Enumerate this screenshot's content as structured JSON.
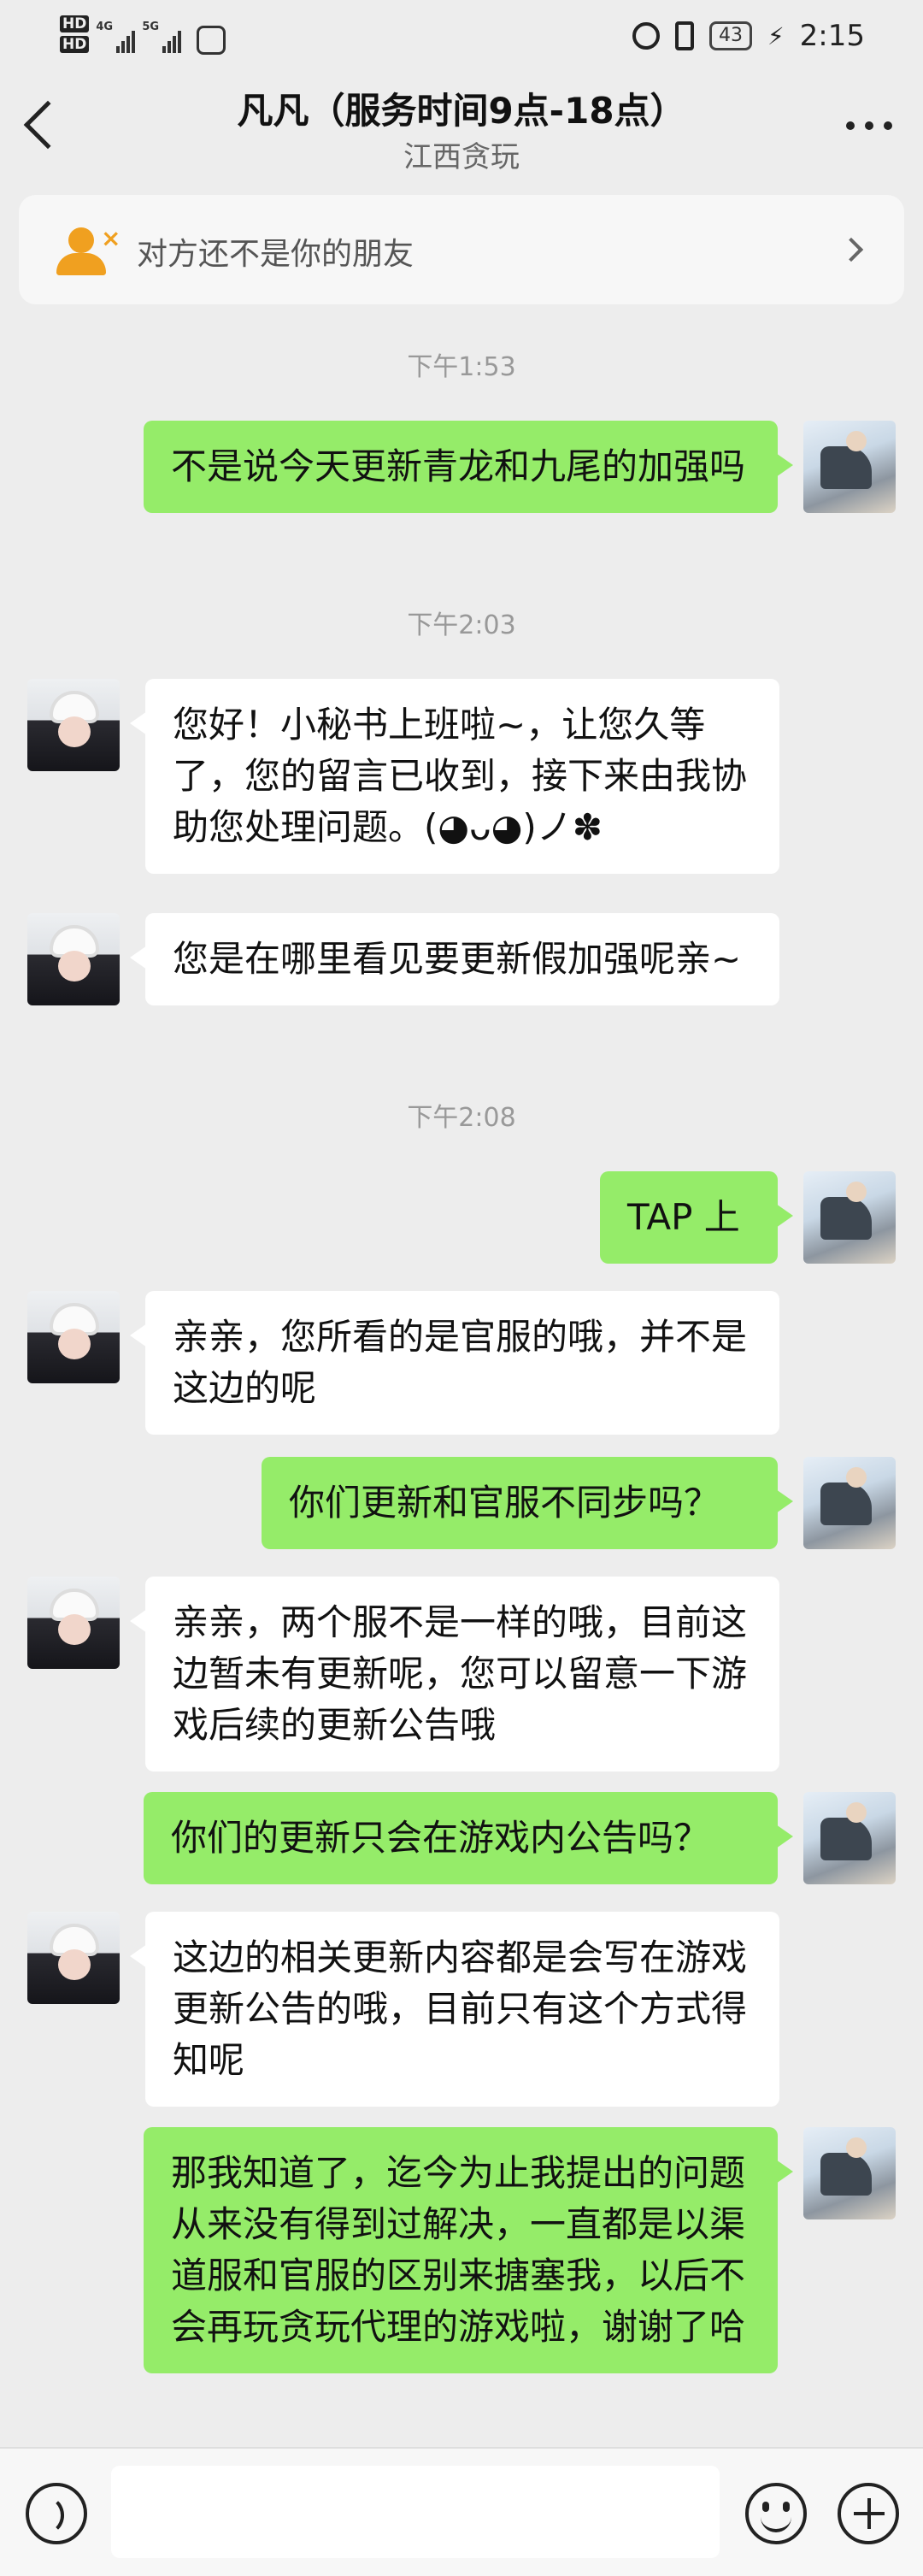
{
  "status_bar": {
    "hd1": "HD",
    "hd2": "HD",
    "net1": "4G",
    "net2": "5G",
    "battery": "43",
    "time": "2:15"
  },
  "header": {
    "title": "凡凡（服务时间9点-18点）",
    "subtitle": "江西贪玩"
  },
  "banner": {
    "text": "对方还不是你的朋友"
  },
  "timestamps": [
    "下午1:53",
    "下午2:03",
    "下午2:08"
  ],
  "messages": [
    {
      "sender": "me",
      "text": "不是说今天更新青龙和九尾的加强吗"
    },
    {
      "sender": "other",
      "text": "您好！小秘书上班啦~，让您久等了，您的留言已收到，接下来由我协助您处理问题。(◕ᴗ◕)ノ✽"
    },
    {
      "sender": "other",
      "text": "您是在哪里看见要更新假加强呢亲~"
    },
    {
      "sender": "me",
      "text": "TAP 上"
    },
    {
      "sender": "other",
      "text": "亲亲，您所看的是官服的哦，并不是这边的呢"
    },
    {
      "sender": "me",
      "text": "你们更新和官服不同步吗？"
    },
    {
      "sender": "other",
      "text": "亲亲，两个服不是一样的哦，目前这边暂未有更新呢，您可以留意一下游戏后续的更新公告哦"
    },
    {
      "sender": "me",
      "text": "你们的更新只会在游戏内公告吗？"
    },
    {
      "sender": "other",
      "text": "这边的相关更新内容都是会写在游戏更新公告的哦，目前只有这个方式得知呢"
    },
    {
      "sender": "me",
      "text": "那我知道了，迄今为止我提出的问题从来没有得到过解决，一直都是以渠道服和官服的区别来搪塞我，以后不会再玩贪玩代理的游戏啦，谢谢了哈"
    }
  ],
  "icons": {
    "back": "back-arrow-icon",
    "more": "more-dots-icon",
    "banner_person": "person-x-icon",
    "banner_chevron": "chevron-right-icon",
    "voice": "voice-icon",
    "emoji": "emoji-icon",
    "plus": "plus-icon"
  },
  "colors": {
    "background": "#ededed",
    "bubble_me": "#95ec69",
    "bubble_other": "#ffffff",
    "banner_icon": "#f0a020"
  }
}
